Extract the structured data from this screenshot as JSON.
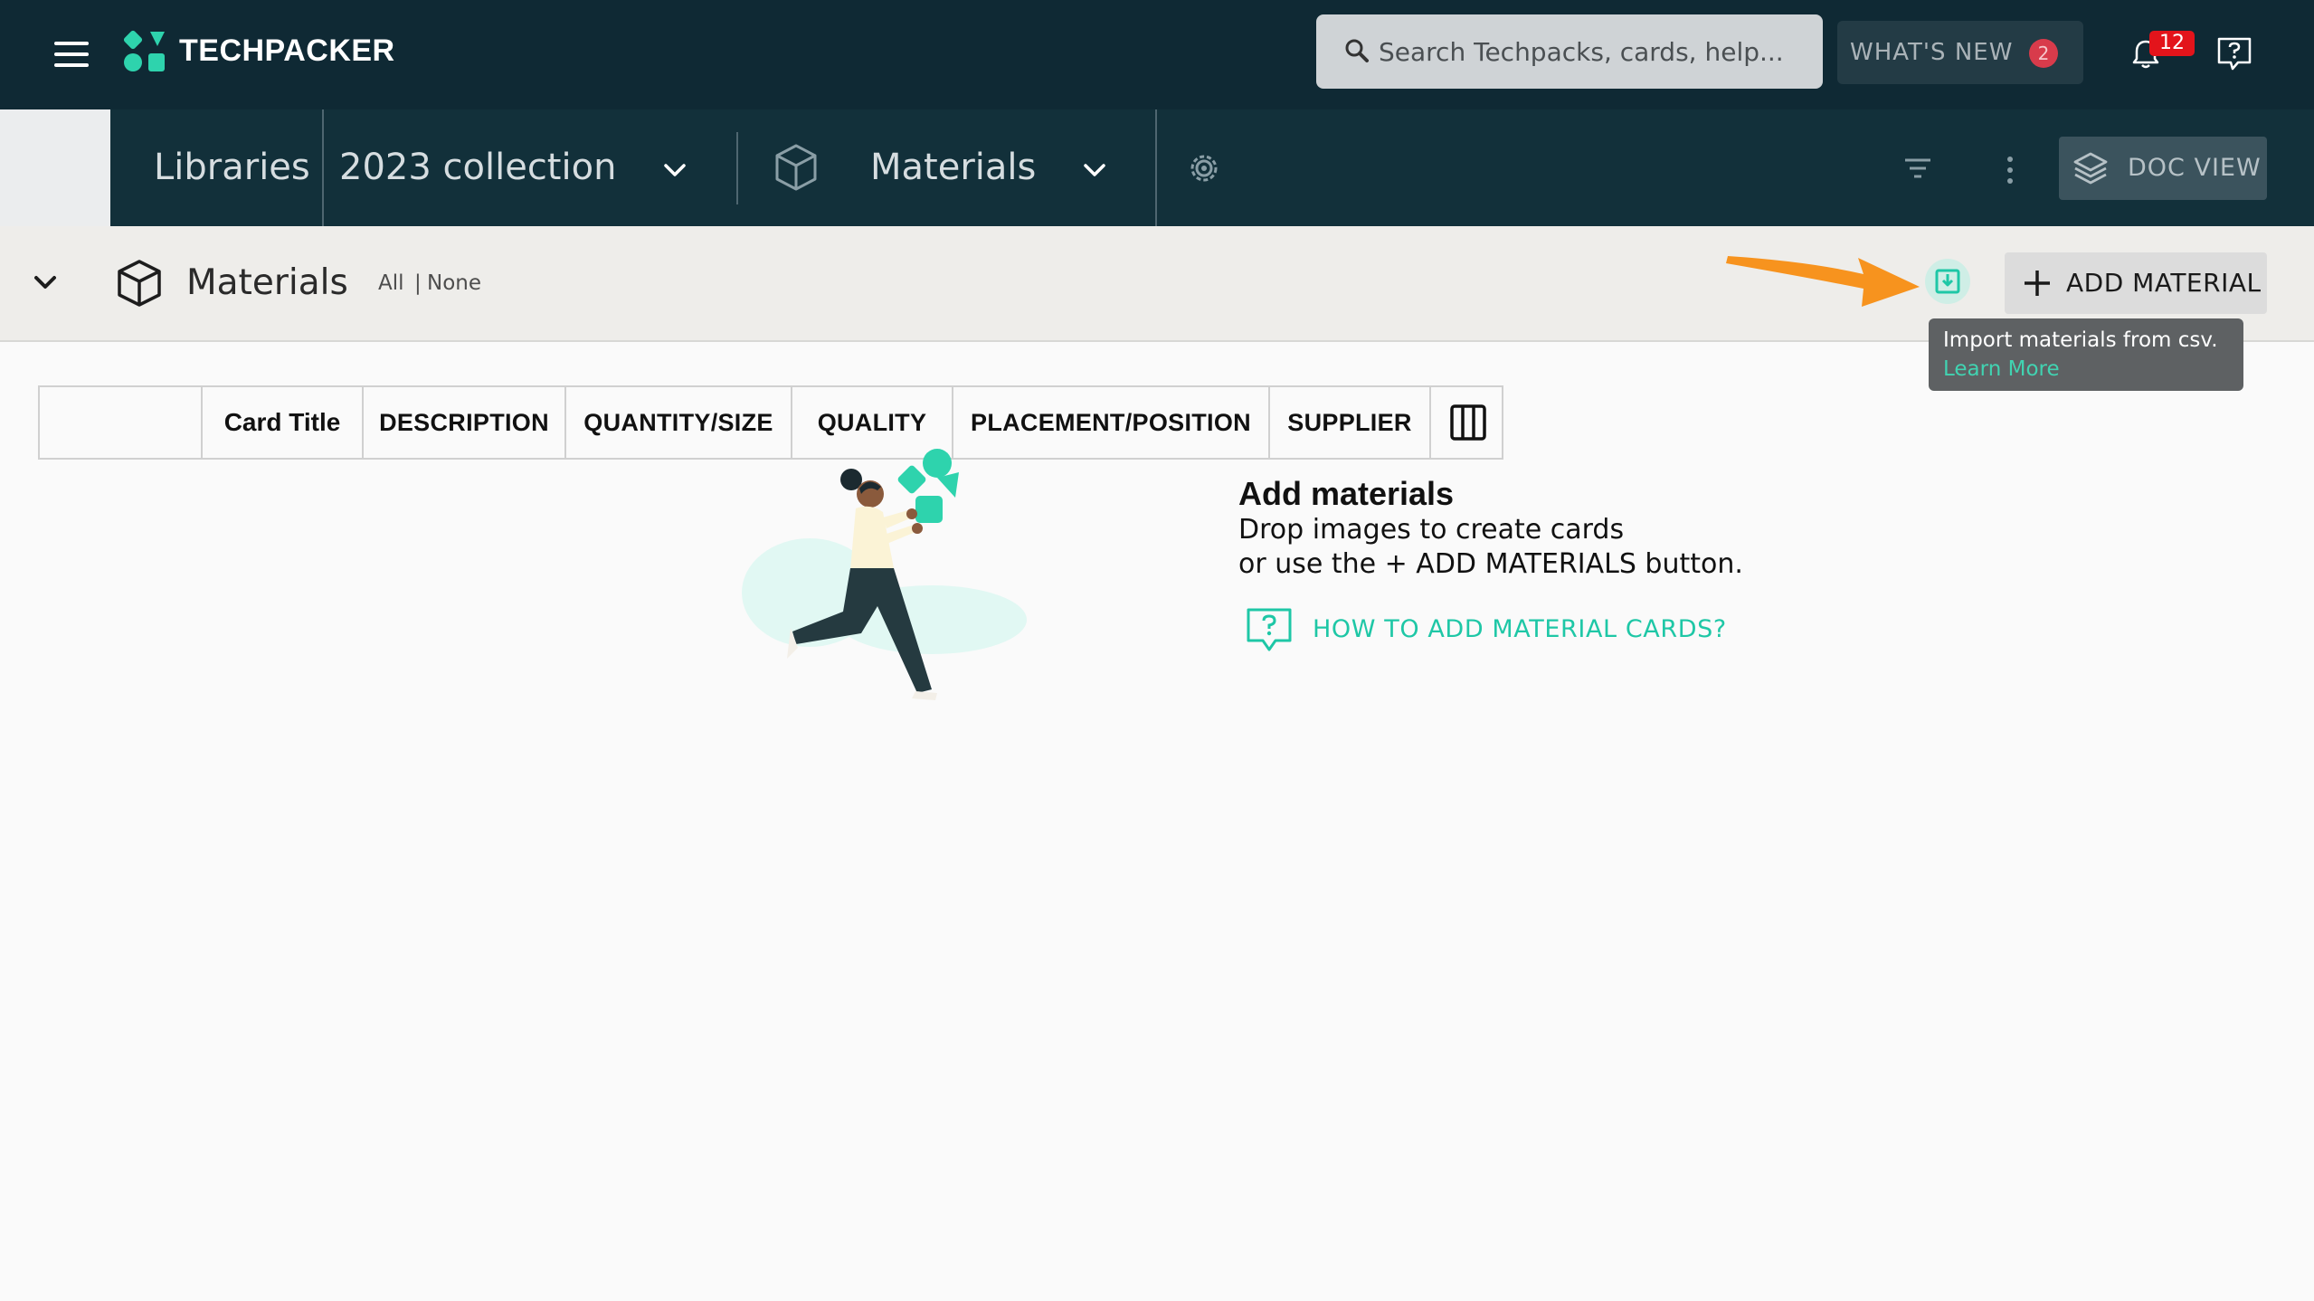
{
  "app": {
    "brand": "TECHPACKER",
    "search_placeholder": "Search Techpacks, cards, help...",
    "whats_new_label": "WHAT'S NEW",
    "whats_new_count": "2",
    "notification_count": "12"
  },
  "navbar": {
    "libraries_label": "Libraries",
    "collection_label": "2023 collection",
    "section_label": "Materials",
    "doc_view_label": "DOC VIEW"
  },
  "section": {
    "title": "Materials",
    "select_all": "All",
    "separator": "|",
    "select_none": "None",
    "add_button_label": "ADD MATERIAL",
    "tooltip_text": "Import materials from csv.",
    "tooltip_link": "Learn More"
  },
  "table": {
    "columns": [
      "",
      "Card Title",
      "DESCRIPTION",
      "QUANTITY/SIZE",
      "QUALITY",
      "PLACEMENT/POSITION",
      "SUPPLIER"
    ]
  },
  "empty_state": {
    "title": "Add materials",
    "line1": "Drop images to create cards",
    "line2": "or use the + ADD MATERIALS button.",
    "help_link": "HOW TO ADD MATERIAL CARDS?"
  },
  "colors": {
    "topbar": "#0f2934",
    "subbar": "#12303a",
    "accent": "#1ec7a6",
    "arrow": "#f7931e",
    "badge": "#d83b4b"
  }
}
